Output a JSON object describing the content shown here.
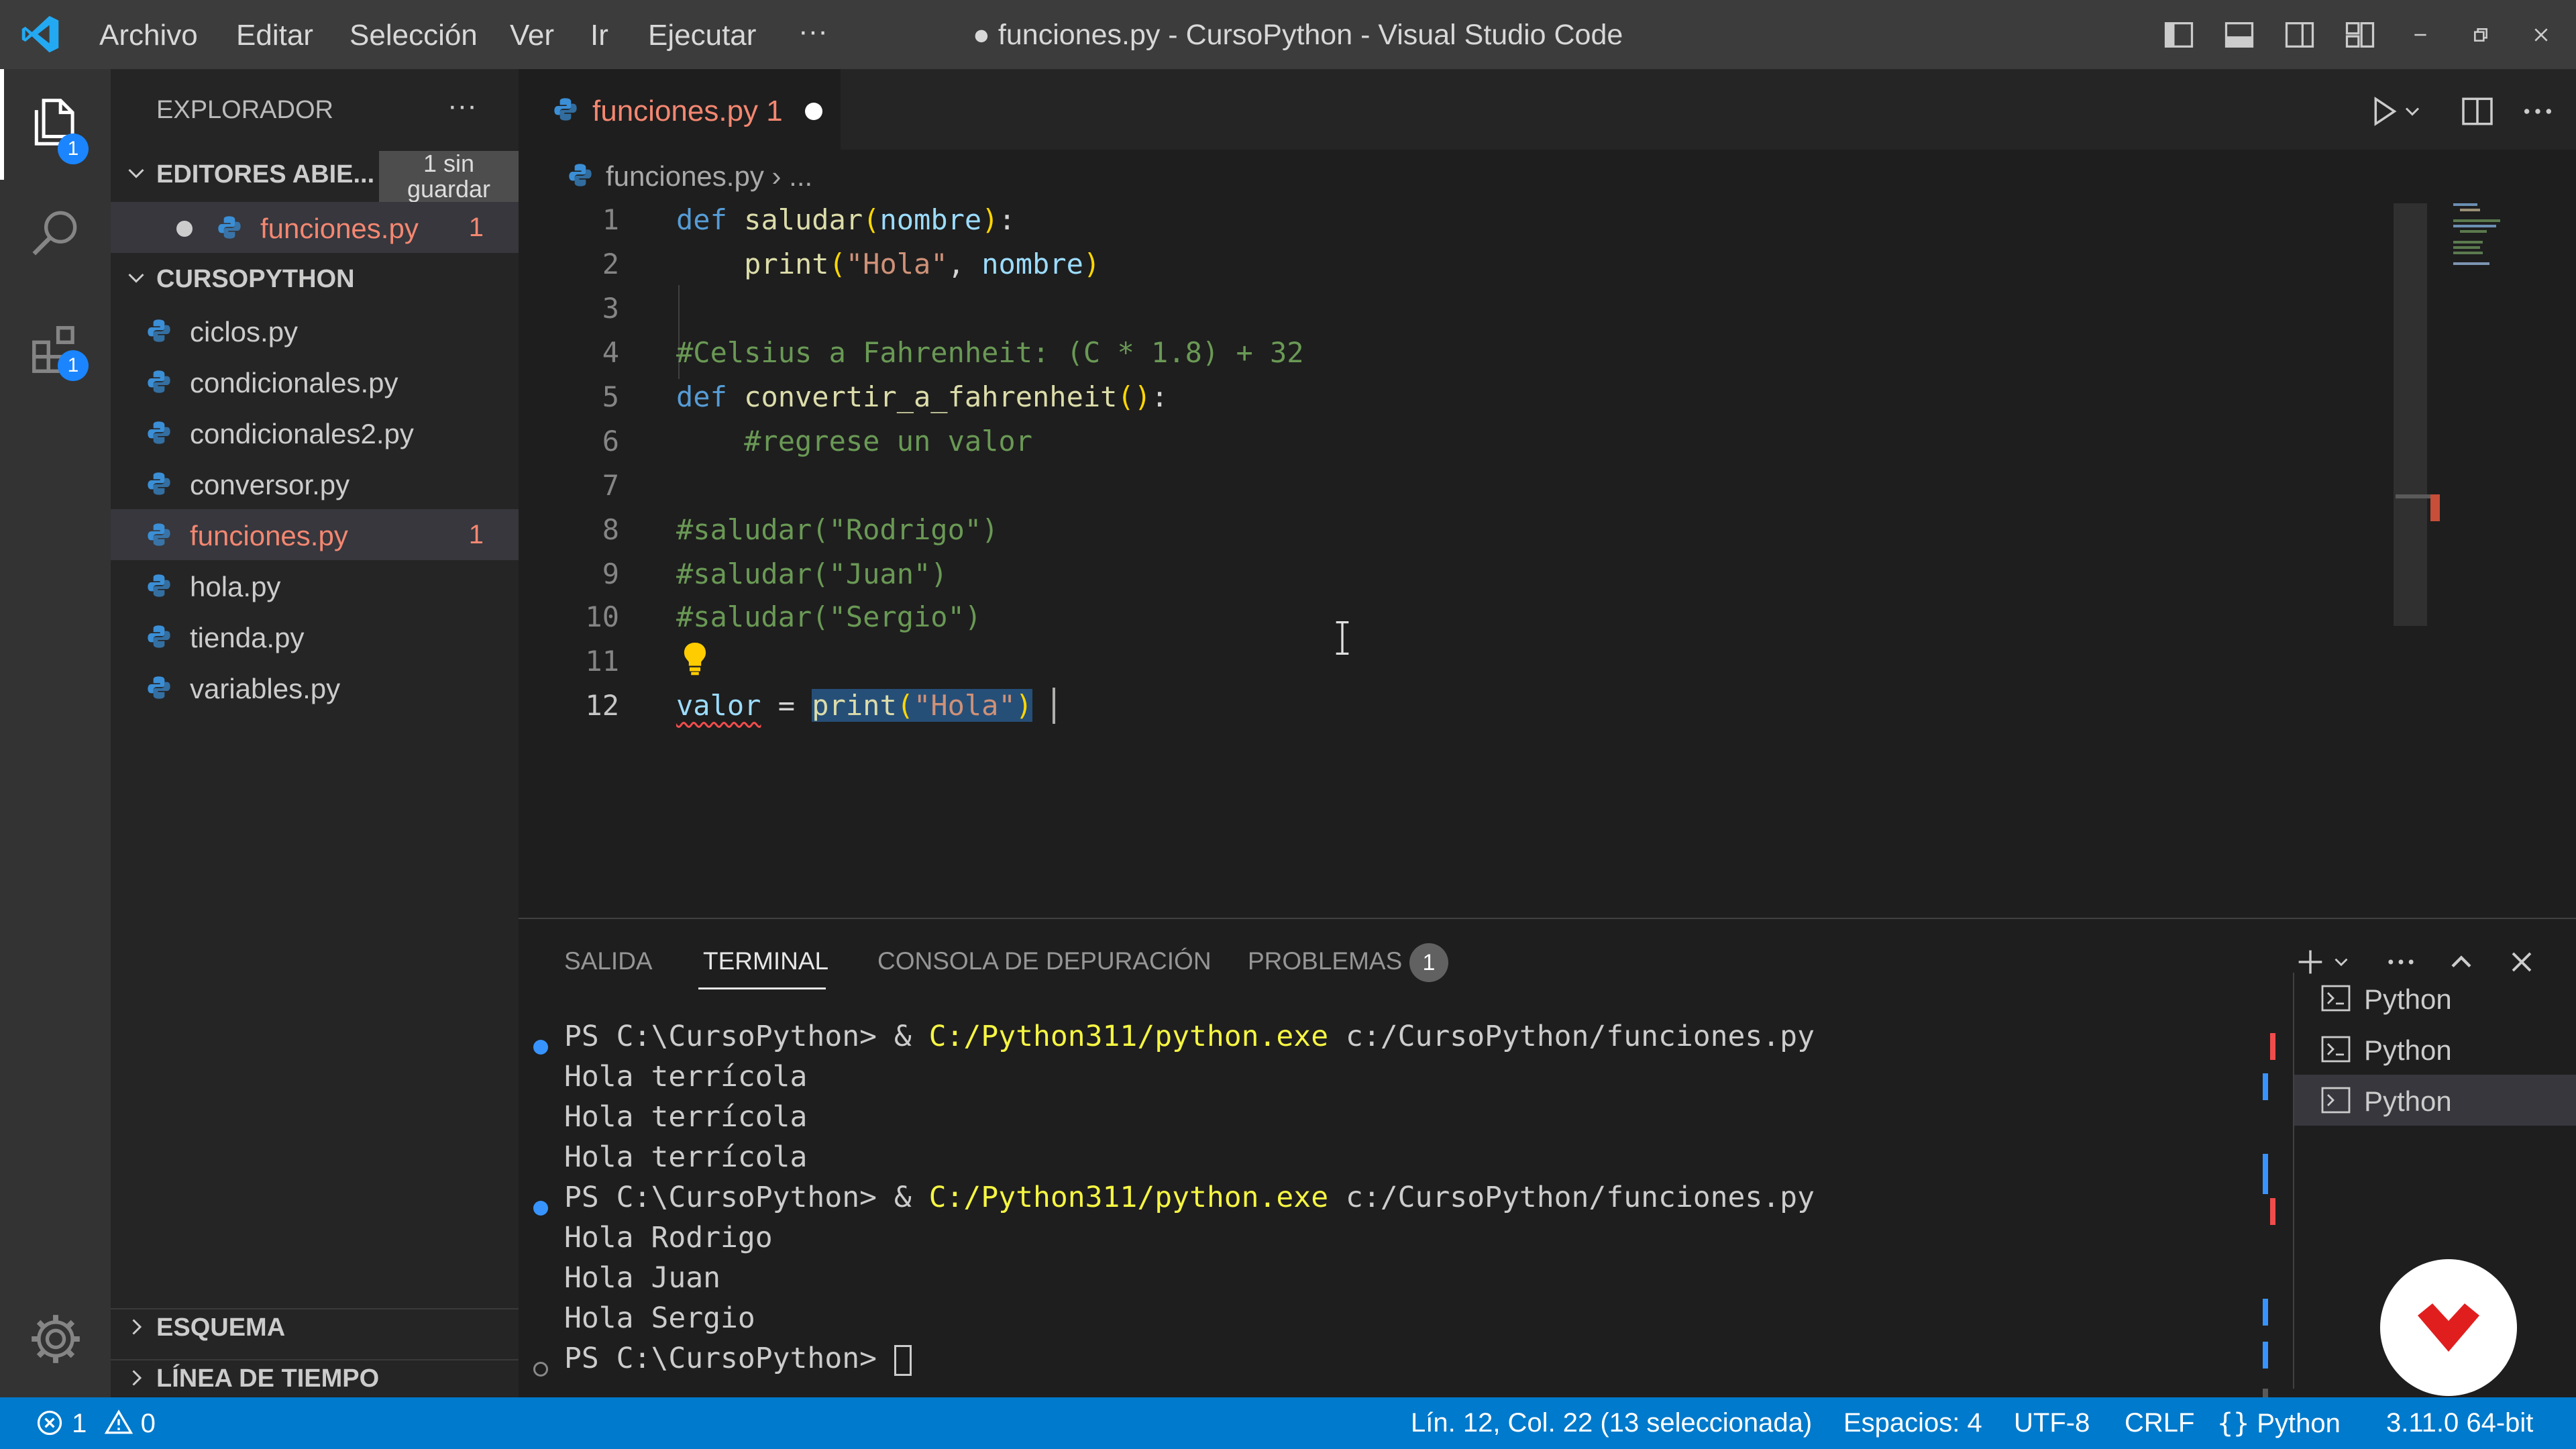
{
  "titlebar": {
    "menu": [
      "Archivo",
      "Editar",
      "Selección",
      "Ver",
      "Ir",
      "Ejecutar",
      "···"
    ],
    "title": "● funciones.py - CursoPython - Visual Studio Code"
  },
  "activitybar": {
    "explorer_badge": "1",
    "extensions_badge": "1"
  },
  "sidebar": {
    "title": "EXPLORADOR",
    "more": "···",
    "open_editors": {
      "label": "EDITORES ABIE...",
      "unsaved_badge": "1 sin guardar",
      "files": [
        {
          "name": "funciones.py",
          "count": "1"
        }
      ]
    },
    "folder": {
      "label": "CURSOPYTHON",
      "files": [
        {
          "name": "ciclos.py"
        },
        {
          "name": "condicionales.py"
        },
        {
          "name": "condicionales2.py"
        },
        {
          "name": "conversor.py"
        },
        {
          "name": "funciones.py",
          "count": "1",
          "active": true
        },
        {
          "name": "hola.py"
        },
        {
          "name": "tienda.py"
        },
        {
          "name": "variables.py"
        }
      ]
    },
    "outline": "ESQUEMA",
    "timeline": "LÍNEA DE TIEMPO"
  },
  "editor": {
    "tab": {
      "label": "funciones.py 1"
    },
    "breadcrumb": "funciones.py  ›  ...",
    "lines": [
      "1",
      "2",
      "3",
      "4",
      "5",
      "6",
      "7",
      "8",
      "9",
      "10",
      "11",
      "12"
    ],
    "code": {
      "l1_def": "def ",
      "l1_name": "saludar",
      "l1_open": "(",
      "l1_param": "nombre",
      "l1_close": ")",
      "l1_colon": ":",
      "l2_indent": "    ",
      "l2_print": "print",
      "l2_open": "(",
      "l2_str": "\"Hola\"",
      "l2_sep": ", ",
      "l2_param": "nombre",
      "l2_close": ")",
      "l4": "#Celsius a Fahrenheit: (C * 1.8) + 32",
      "l5_def": "def ",
      "l5_name": "convertir_a_fahrenheit",
      "l5_parens": "()",
      "l5_colon": ":",
      "l6": "    #regrese un valor",
      "l8": "#saludar(\"Rodrigo\")",
      "l9": "#saludar(\"Juan\")",
      "l10": "#saludar(\"Sergio\")",
      "l12_var": "valor",
      "l12_eq": " = ",
      "l12_print": "print",
      "l12_open": "(",
      "l12_str": "\"Hola\"",
      "l12_close": ")"
    }
  },
  "panel": {
    "tabs": [
      "SALIDA",
      "TERMINAL",
      "CONSOLA DE DEPURACIÓN",
      "PROBLEMAS"
    ],
    "active_tab": "TERMINAL",
    "problems_count": "1",
    "terminal": {
      "prompt": "PS C:\\CursoPython> & ",
      "exe": "C:/Python311/python.exe",
      "script": " c:/CursoPython/funciones.py",
      "out1": "Hola terrícola",
      "out2": "Hola terrícola",
      "out3": "Hola terrícola",
      "out4": "Hola Rodrigo",
      "out5": "Hola Juan",
      "out6": "Hola Sergio",
      "last_prompt": "PS C:\\CursoPython> "
    },
    "terminal_list": [
      "Python",
      "Python",
      "Python"
    ]
  },
  "statusbar": {
    "errors": "1",
    "warnings": "0",
    "position": "Lín. 12, Col. 22 (13 seleccionada)",
    "spaces": "Espacios: 4",
    "encoding": "UTF-8",
    "eol": "CRLF",
    "language": "Python",
    "interpreter": "3.11.0 64-bit"
  },
  "colors": {
    "statusbar": "#007acc",
    "titlebar": "#3c3c3c",
    "error_text": "#f48771",
    "selection": "#264f78"
  }
}
